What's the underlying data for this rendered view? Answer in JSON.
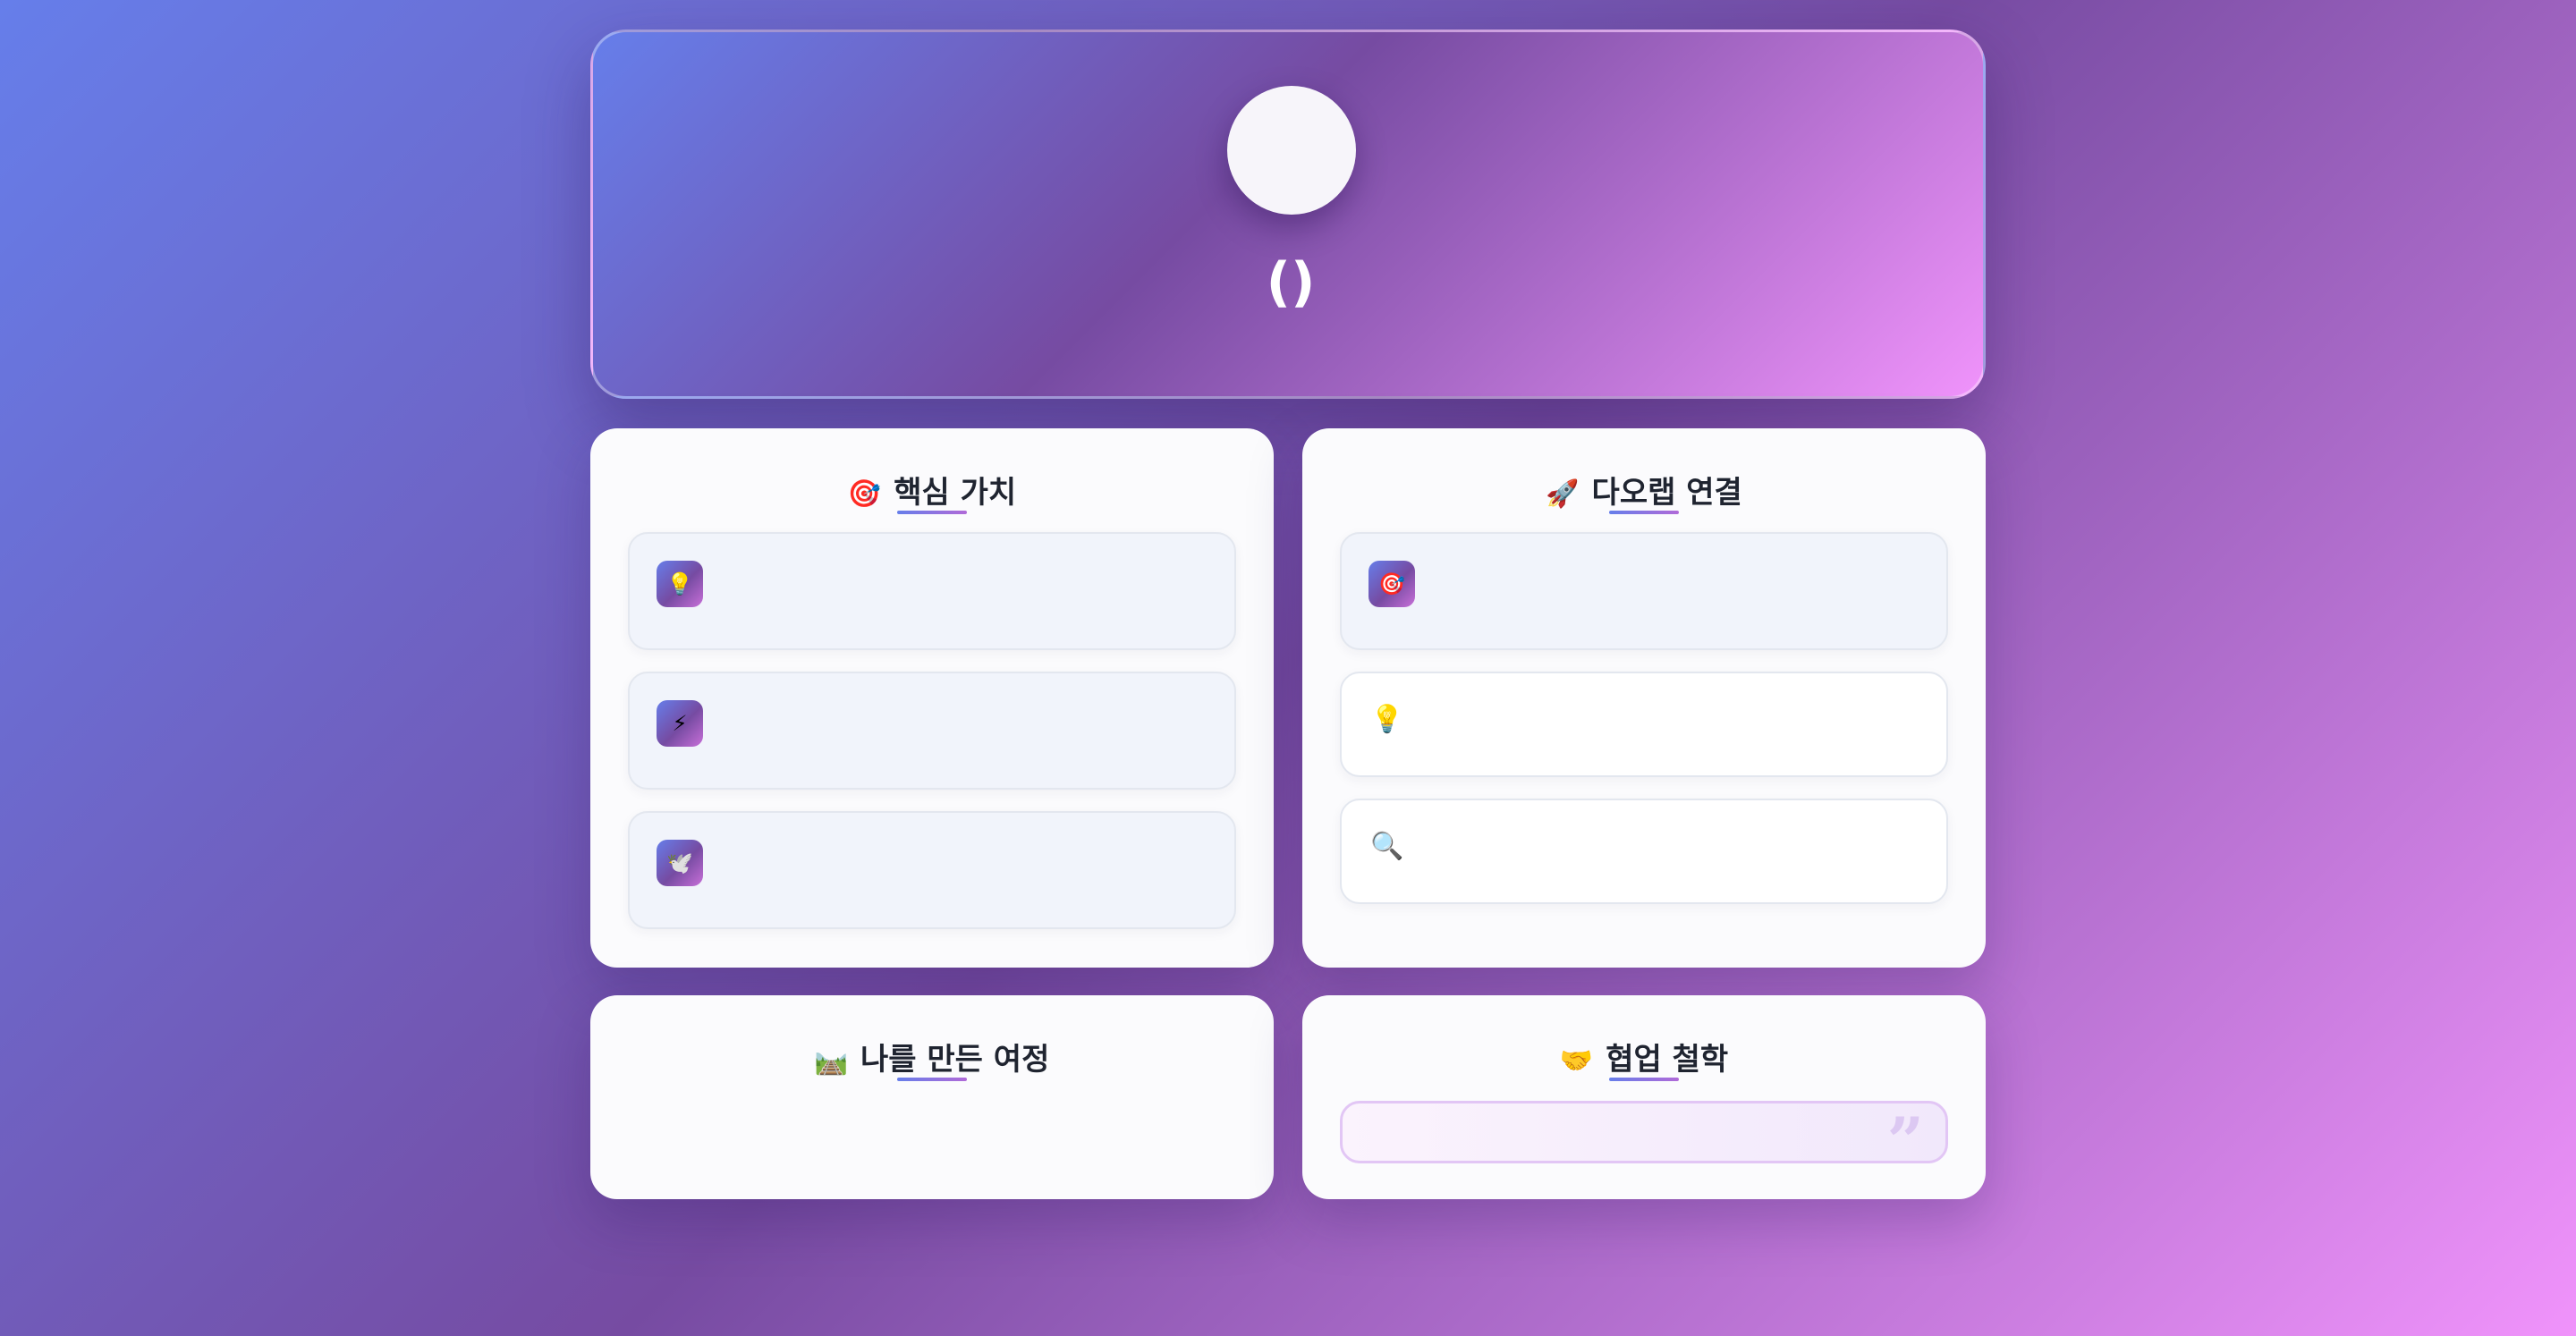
{
  "header": {
    "name_text": "()"
  },
  "cards": {
    "core_values": {
      "emoji": "🎯",
      "title": "핵심 가치",
      "items": [
        {
          "icon": "💡"
        },
        {
          "icon": "⚡"
        },
        {
          "icon": "🕊️"
        }
      ]
    },
    "daoraep": {
      "emoji": "🚀",
      "title": "다오랩 연결",
      "items": [
        {
          "icon": "🎯"
        },
        {
          "icon": "💡"
        },
        {
          "icon": "🔍"
        }
      ]
    },
    "journey": {
      "emoji": "🛤️",
      "title": "나를 만든 여정"
    },
    "collaboration": {
      "emoji": "🤝",
      "title": "협업 철학",
      "quote_mark": "”"
    }
  },
  "colors": {
    "accent_start": "#667eea",
    "accent_mid": "#764ba2",
    "accent_end": "#f093fb"
  }
}
